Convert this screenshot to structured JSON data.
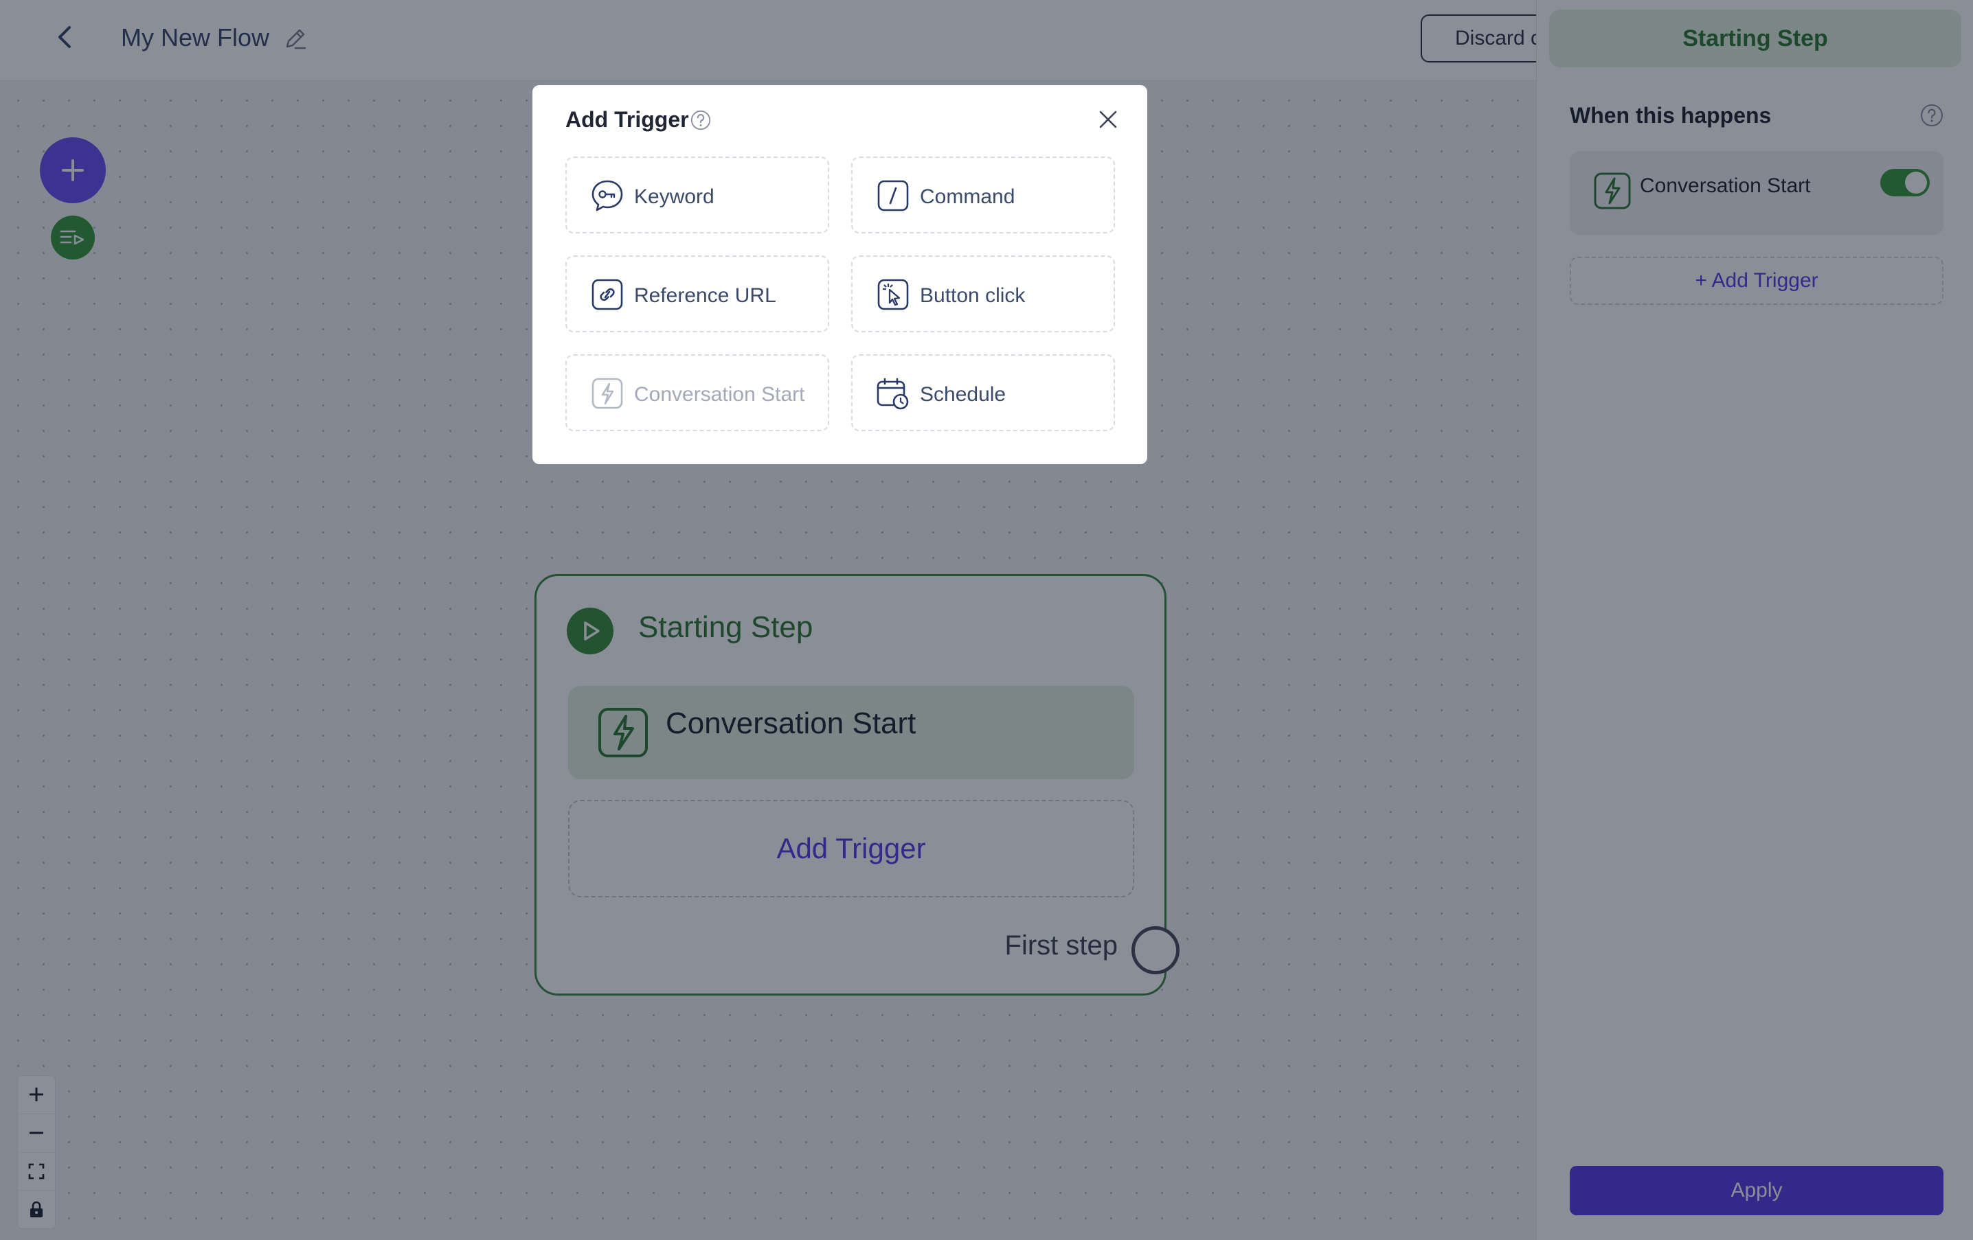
{
  "header": {
    "flow_title": "My New Flow",
    "discard_label": "Discard changes"
  },
  "step_node": {
    "title": "Starting Step",
    "trigger_label": "Conversation Start",
    "add_trigger_label": "Add Trigger",
    "first_step_label": "First step"
  },
  "side_panel": {
    "header": "Starting Step",
    "section_title": "When this happens",
    "trigger_label": "Conversation Start",
    "trigger_enabled": true,
    "add_trigger_label": "+ Add Trigger",
    "apply_label": "Apply"
  },
  "modal": {
    "title": "Add Trigger",
    "options": [
      {
        "label": "Keyword",
        "icon": "keyword-icon",
        "disabled": false
      },
      {
        "label": "Command",
        "icon": "command-icon",
        "disabled": false
      },
      {
        "label": "Reference URL",
        "icon": "link-icon",
        "disabled": false
      },
      {
        "label": "Button click",
        "icon": "cursor-click-icon",
        "disabled": false
      },
      {
        "label": "Conversation Start",
        "icon": "lightning-icon",
        "disabled": true
      },
      {
        "label": "Schedule",
        "icon": "calendar-clock-icon",
        "disabled": false
      }
    ]
  },
  "colors": {
    "brand_purple": "#5b3ee8",
    "brand_green": "#3a8f3c",
    "text_dark": "#1f2533",
    "text_muted": "#3b4a6b"
  }
}
